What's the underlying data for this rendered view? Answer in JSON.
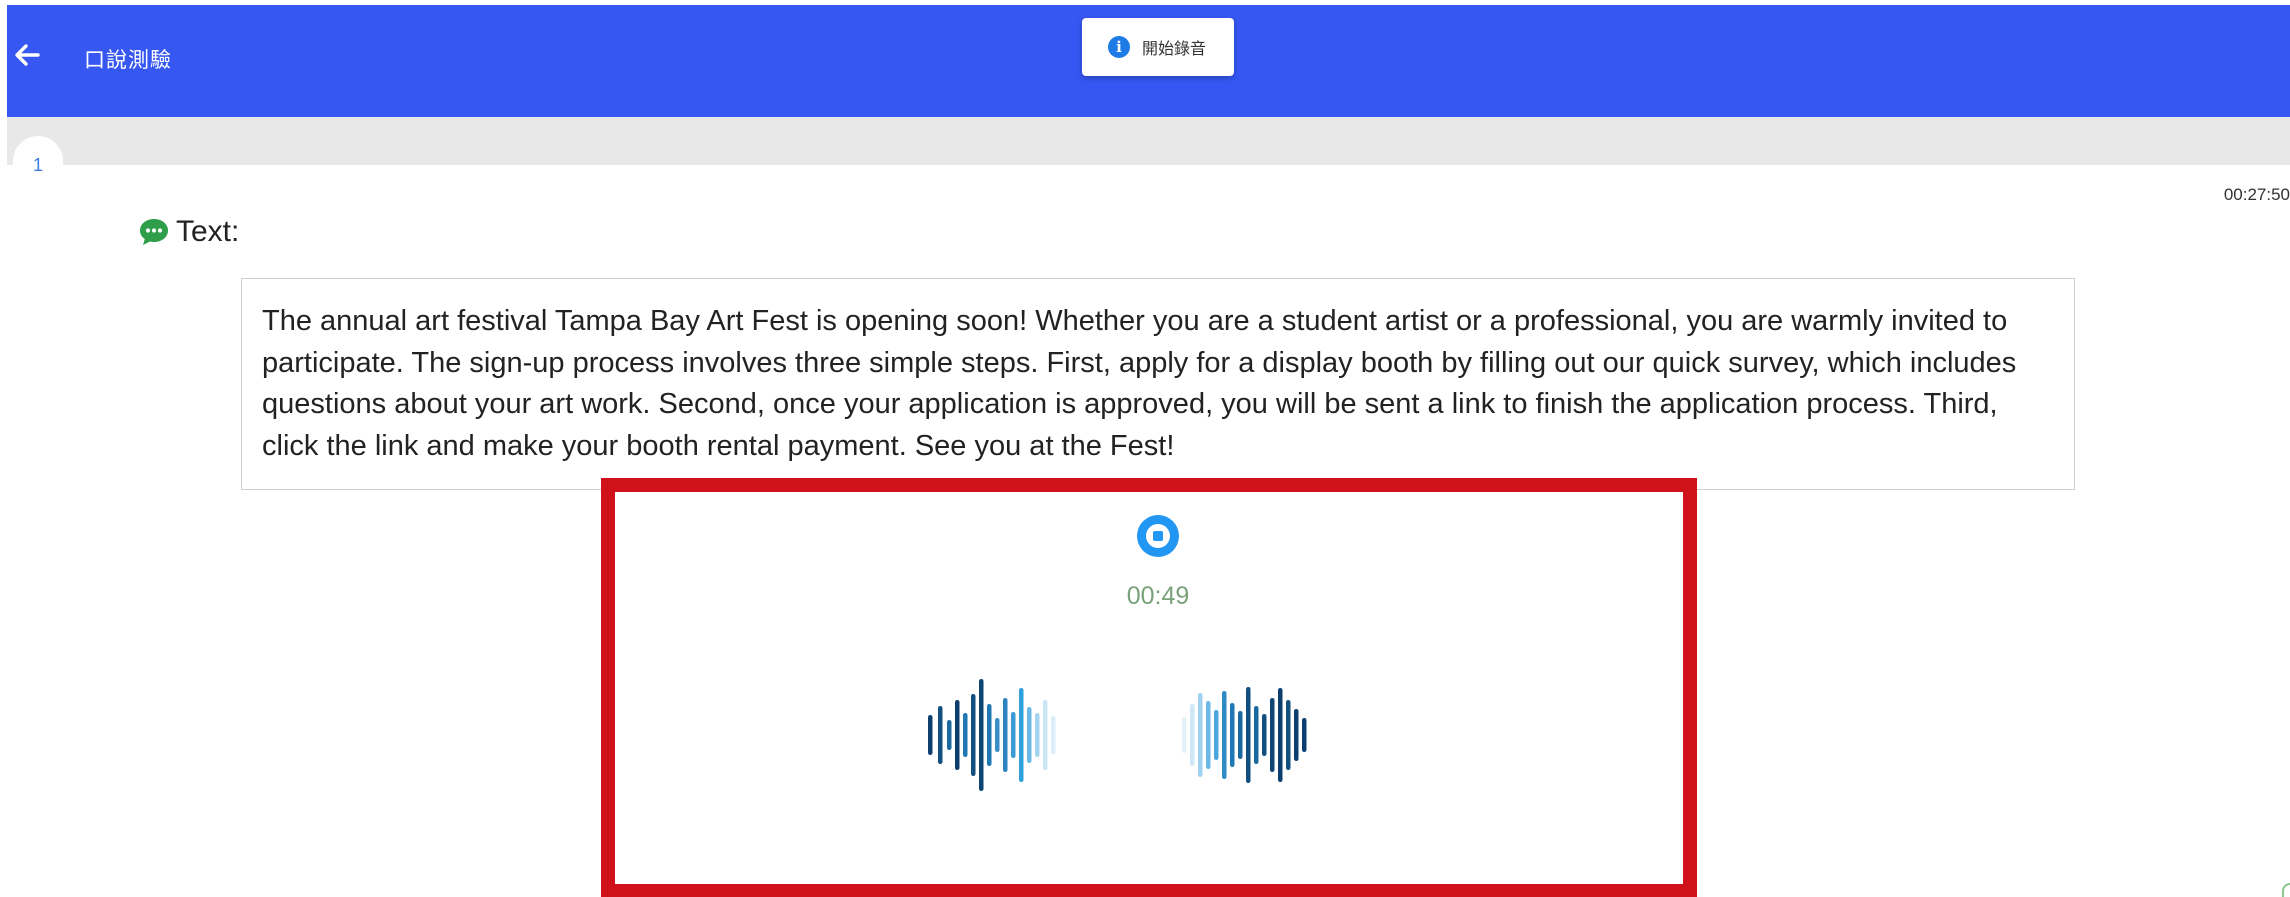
{
  "header": {
    "back_icon": "arrow-left-icon",
    "title": "口說測驗"
  },
  "toast": {
    "icon": "info-icon",
    "icon_glyph": "i",
    "message": "開始錄音"
  },
  "question": {
    "number": "1",
    "timer": "00:27:50"
  },
  "passage": {
    "label_icon": "chat-bubble-icon",
    "label": "Text:",
    "body": "The annual art festival Tampa Bay Art Fest is opening soon! Whether you are a student artist or a professional, you are warmly invited to participate. The sign-up process involves three simple steps. First, apply for a display booth by filling out our quick survey, which includes questions about your art work. Second, once your application is approved, you will be sent a link to finish the application process. Third, click the link and make your booth rental payment. See you at the Fest!"
  },
  "recorder": {
    "stop_icon": "stop-record-icon",
    "elapsed": "00:49",
    "waveform_icon": "audio-waveform-icon"
  },
  "colors": {
    "header_bg": "#3657f2",
    "highlight_frame": "#d0101a",
    "stop_button": "#2196f3",
    "elapsed_text": "#7aa27a",
    "chat_icon": "#2e9e4a",
    "question_number": "#3d7be0"
  }
}
